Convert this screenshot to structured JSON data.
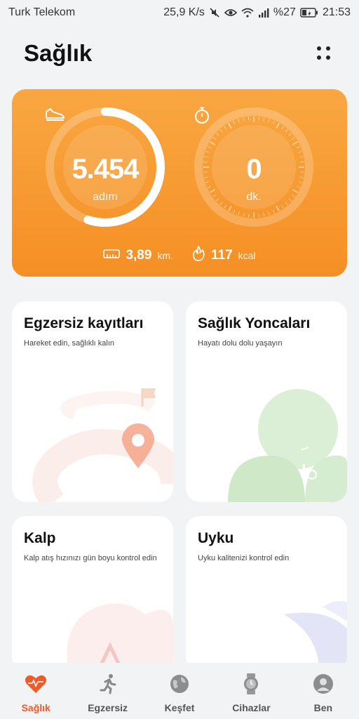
{
  "status_bar": {
    "carrier": "Turk Telekom",
    "speed": "25,9 K/s",
    "battery": "%27",
    "time": "21:53"
  },
  "header": {
    "title": "Sağlık"
  },
  "activity": {
    "steps": "5.454",
    "steps_unit": "adım",
    "steps_progress": 0.55,
    "minutes": "0",
    "minutes_unit": "dk.",
    "distance": "3,89",
    "distance_unit": "km.",
    "calories": "117",
    "calories_unit": "kcal",
    "accent": "#f58f24"
  },
  "tiles": {
    "egzersiz": {
      "title": "Egzersiz kayıtları",
      "subtitle": "Hareket edin, sağlıklı kalın"
    },
    "yonca": {
      "title": "Sağlık Yoncaları",
      "subtitle": "Hayatı dolu dolu yaşayın"
    },
    "kalp": {
      "title": "Kalp",
      "subtitle": "Kalp atış hızınızı gün boyu kontrol edin"
    },
    "uyku": {
      "title": "Uyku",
      "subtitle": "Uyku kalitenizi kontrol edin"
    }
  },
  "nav": {
    "items": [
      {
        "label": "Sağlık",
        "icon": "heart-icon",
        "active": true
      },
      {
        "label": "Egzersiz",
        "icon": "running-icon",
        "active": false
      },
      {
        "label": "Keşfet",
        "icon": "globe-icon",
        "active": false
      },
      {
        "label": "Cihazlar",
        "icon": "watch-icon",
        "active": false
      },
      {
        "label": "Ben",
        "icon": "user-icon",
        "active": false
      }
    ],
    "active_color": "#ee5a2a"
  }
}
